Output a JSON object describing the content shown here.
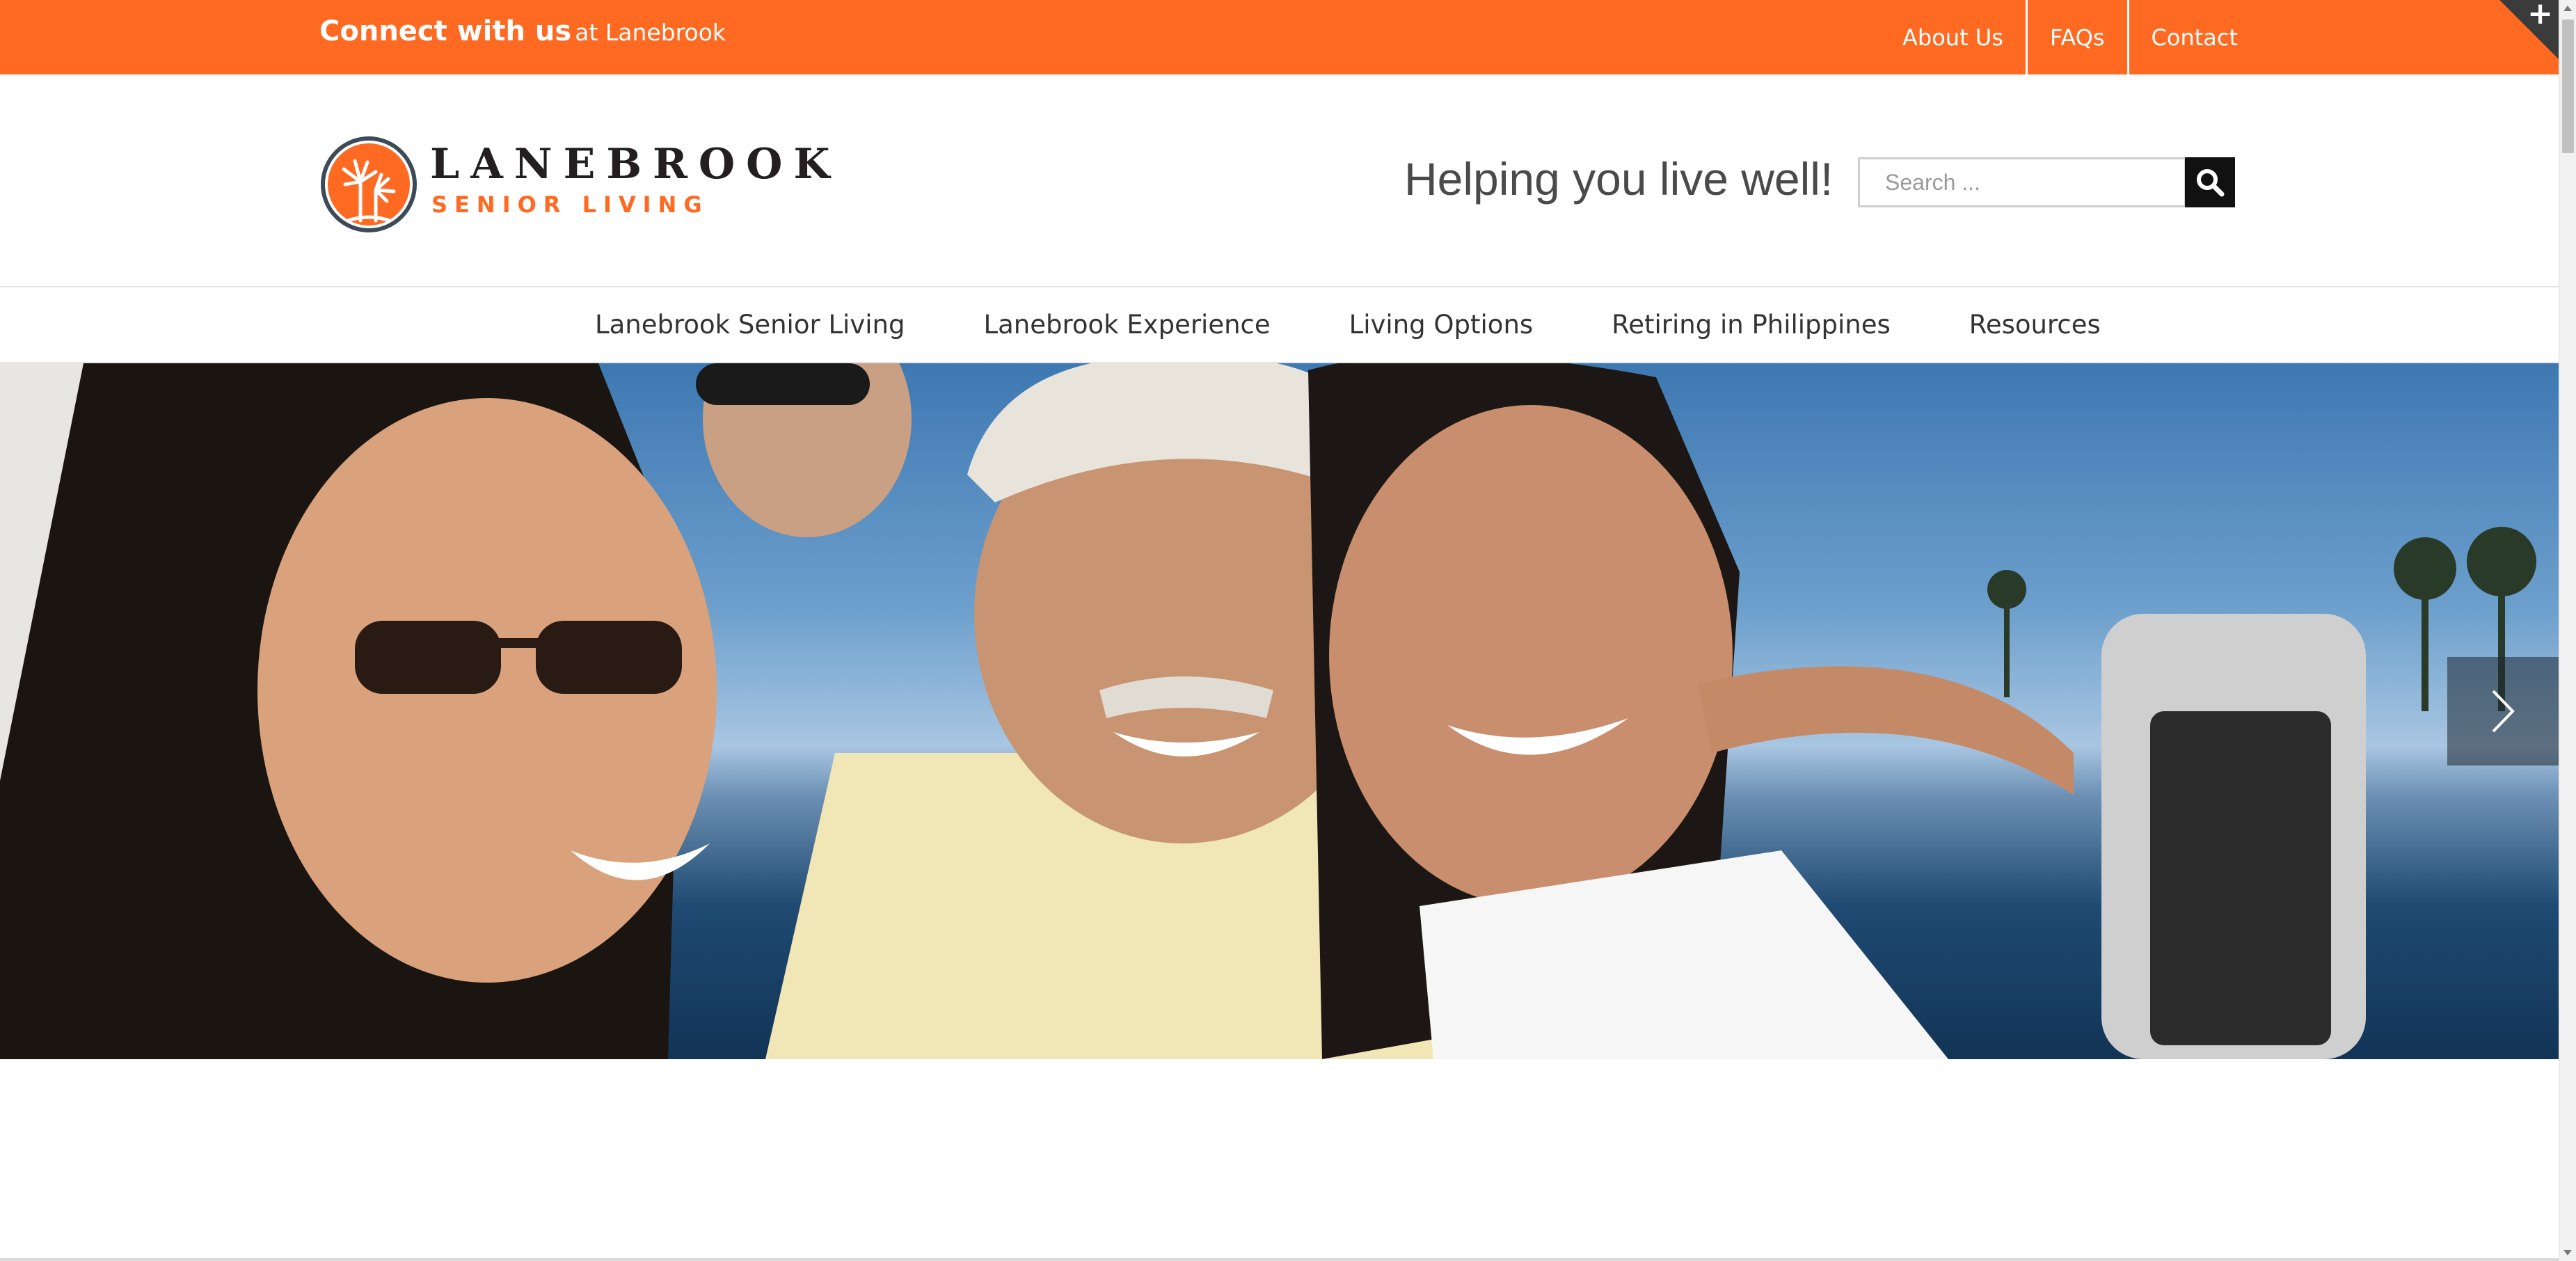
{
  "topbar": {
    "connect_bold": "Connect with us",
    "connect_rest": "at Lanebrook",
    "links": [
      "About Us",
      "FAQs",
      "Contact"
    ],
    "corner_symbol": "+",
    "color": "#ff6a22"
  },
  "header": {
    "logo_line1": "LANEBROOK",
    "logo_line2": "SENIOR LIVING",
    "tagline": "Helping you live well!",
    "search_placeholder": "Search ...",
    "search_icon": "search-icon"
  },
  "nav": {
    "items": [
      "Lanebrook Senior Living",
      "Lanebrook Experience",
      "Living Options",
      "Retiring in Philippines",
      "Resources"
    ]
  },
  "hero": {
    "next_icon": "chevron-right-icon"
  }
}
